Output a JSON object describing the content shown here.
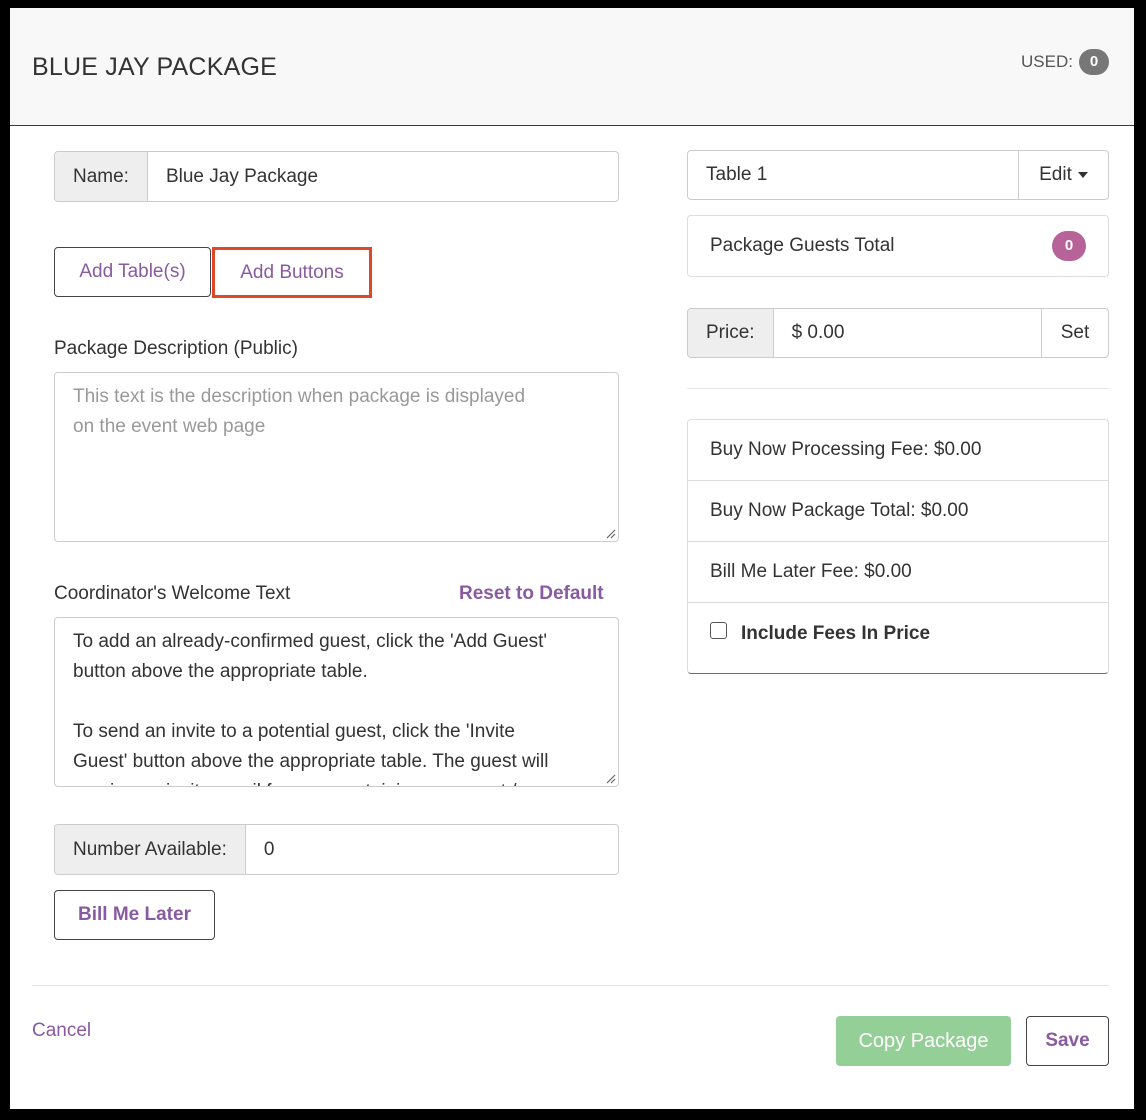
{
  "header": {
    "title": "BLUE JAY PACKAGE",
    "used_label": "USED:",
    "used_count": "0"
  },
  "form": {
    "name_label": "Name:",
    "name_value": "Blue Jay Package",
    "add_tables_button": "Add Table(s)",
    "add_buttons_button": "Add Buttons",
    "description_label": "Package Description (Public)",
    "description_placeholder_line1": "This text is the description when package is displayed",
    "description_placeholder_line2": "on the event web page",
    "welcome_label": "Coordinator's Welcome Text",
    "reset_link": "Reset to Default",
    "welcome_lines": [
      "To add an already-confirmed guest, click the 'Add Guest'",
      "button above the appropriate table.",
      "",
      "To send an invite to a potential guest, click the 'Invite",
      "Guest' button above the appropriate table. The guest will",
      "receive an invite email for you, containing a request / ..."
    ],
    "number_available_label": "Number Available:",
    "number_available_value": "0",
    "bill_me_later_button": "Bill Me Later"
  },
  "sidebar": {
    "table_name": "Table 1",
    "edit_label": "Edit",
    "guests_total_label": "Package Guests Total",
    "guests_total_count": "0",
    "price_label": "Price:",
    "price_value": "$ 0.00",
    "set_button": "Set",
    "fees": {
      "processing_fee": "Buy Now Processing Fee: $0.00",
      "package_total": "Buy Now Package Total: $0.00",
      "bill_later_fee": "Bill Me Later Fee: $0.00",
      "include_fees_label": "Include Fees In Price"
    }
  },
  "footer": {
    "cancel_label": "Cancel",
    "copy_button": "Copy Package",
    "save_button": "Save"
  },
  "colors": {
    "accent_purple": "#8a5aa0",
    "highlight_red": "#e0462a",
    "badge_pink": "#b7639a",
    "copy_green": "#95cf98"
  }
}
